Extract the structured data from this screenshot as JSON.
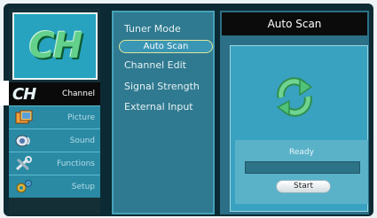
{
  "logo": {
    "text": "CH"
  },
  "sidebar": {
    "items": [
      {
        "label": "Channel",
        "icon": "ch-logo-icon",
        "active": true
      },
      {
        "label": "Picture",
        "icon": "picture-icon",
        "active": false
      },
      {
        "label": "Sound",
        "icon": "speaker-icon",
        "active": false
      },
      {
        "label": "Functions",
        "icon": "tools-icon",
        "active": false
      },
      {
        "label": "Setup",
        "icon": "gears-icon",
        "active": false
      }
    ]
  },
  "menu": {
    "items": [
      {
        "label": "Tuner Mode",
        "selected": false
      },
      {
        "label": "Auto Scan",
        "selected": true
      },
      {
        "label": "Channel Edit",
        "selected": false
      },
      {
        "label": "Signal Strength",
        "selected": false
      },
      {
        "label": "External Input",
        "selected": false
      }
    ]
  },
  "panel": {
    "title": "Auto Scan",
    "icon": "refresh-icon",
    "status": "Ready",
    "progress": 0,
    "start_label": "Start"
  },
  "colors": {
    "accent_green": "#4fc178",
    "panel_blue": "#39a2c0",
    "header_black": "#0b0b0b"
  }
}
